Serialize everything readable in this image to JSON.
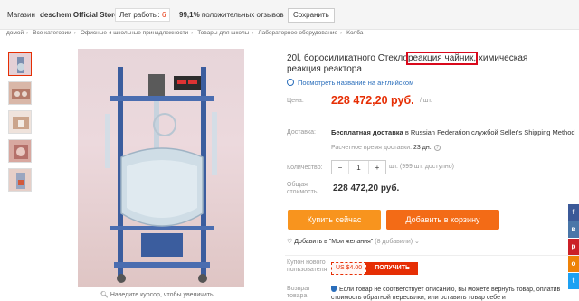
{
  "store": {
    "label": "Магазин",
    "name": "deschem Official Store",
    "years_label": "Лет работы:",
    "years_value": "6",
    "feedback_value": "99,1%",
    "feedback_label": "положительных отзывов",
    "save_label": "Сохранить"
  },
  "breadcrumb": [
    "домой",
    "Все категории",
    "Офисные и школьные принадлежности",
    "Товары для школы",
    "Лабораторное оборудование",
    "Колба"
  ],
  "product": {
    "title_before": "20l, боросиликатного Стекло",
    "title_highlight": "реакция чайник,",
    "title_after": " химическая реакция реактора",
    "translate_link": "Посмотреть название на английском",
    "price_label": "Цена:",
    "price": "228 472,20 руб.",
    "price_unit": "/ шт.",
    "shipping_label": "Доставка:",
    "shipping_free": "Бесплатная доставка",
    "shipping_rest": " в Russian Federation службой Seller's Shipping Method",
    "delivery_label": "Расчетное время доставки:",
    "delivery_value": "23 дн.",
    "quantity_label": "Количество:",
    "quantity_value": "1",
    "quantity_minus": "−",
    "quantity_plus": "+",
    "quantity_note": "шт. (999 шт. доступно)",
    "total_label_1": "Общая",
    "total_label_2": "стоимость:",
    "total": "228 472,20 руб.",
    "buy_now": "Купить сейчас",
    "add_to_cart": "Добавить в корзину",
    "wishlist_text": "Добавить в \"Мои желания\"",
    "wishlist_count": "(8 добавили)",
    "coupon_label": "Купон нового пользователя",
    "coupon_amount": "US $4.00",
    "coupon_get": "ПОЛУЧИТЬ",
    "return_label": "Возврат товара",
    "return_text": "Если товар не соответствует описанию, вы можете вернуть товар, оплатив стоимость обратной пересылки, или оставить товар себе и"
  },
  "zoom_hint": "Наведите курсор, чтобы увеличить",
  "social": [
    {
      "icon": "facebook-icon",
      "glyph": "f",
      "color": "#3b5998"
    },
    {
      "icon": "vk-icon",
      "glyph": "в",
      "color": "#4a76a8"
    },
    {
      "icon": "pinterest-icon",
      "glyph": "p",
      "color": "#cb2027"
    },
    {
      "icon": "odnoklassniki-icon",
      "glyph": "о",
      "color": "#ee8208"
    },
    {
      "icon": "twitter-icon",
      "glyph": "t",
      "color": "#1da1f2"
    }
  ],
  "colors": {
    "accent": "#e62e04",
    "buy": "#f8941e",
    "cart": "#f36b16",
    "link": "#2a6ebb",
    "highlight_box": "#d9091c"
  }
}
